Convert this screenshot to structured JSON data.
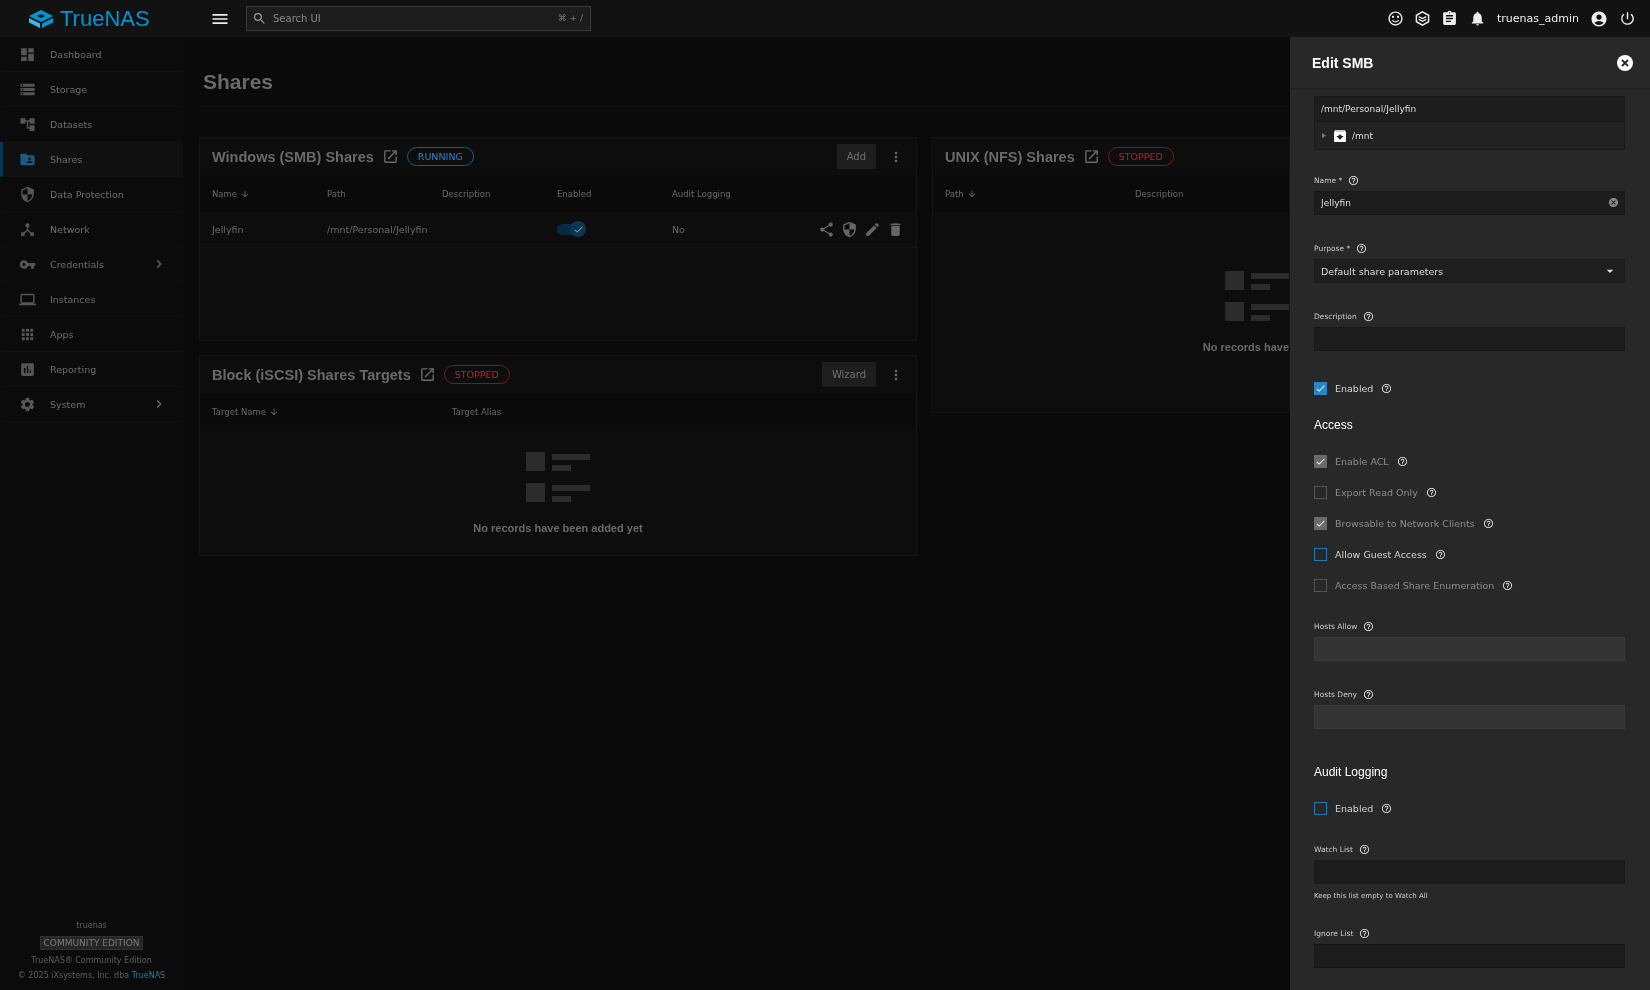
{
  "topbar": {
    "brand": "TrueNAS",
    "search": {
      "placeholder": "Search UI",
      "shortcut": "⌘ + /"
    },
    "user": "truenas_admin"
  },
  "sidebar": {
    "items": [
      {
        "label": "Dashboard",
        "selected": false,
        "has_submenu": false
      },
      {
        "label": "Storage",
        "selected": false,
        "has_submenu": false
      },
      {
        "label": "Datasets",
        "selected": false,
        "has_submenu": false
      },
      {
        "label": "Shares",
        "selected": true,
        "has_submenu": false
      },
      {
        "label": "Data Protection",
        "selected": false,
        "has_submenu": false
      },
      {
        "label": "Network",
        "selected": false,
        "has_submenu": false
      },
      {
        "label": "Credentials",
        "selected": false,
        "has_submenu": true
      },
      {
        "label": "Instances",
        "selected": false,
        "has_submenu": false
      },
      {
        "label": "Apps",
        "selected": false,
        "has_submenu": false
      },
      {
        "label": "Reporting",
        "selected": false,
        "has_submenu": false
      },
      {
        "label": "System",
        "selected": false,
        "has_submenu": true
      }
    ],
    "footer": {
      "hostname": "truenas",
      "edition": "COMMUNITY EDITION",
      "product": "TrueNAS® Community Edition",
      "copyright": "© 2025 iXsystems, Inc. dba",
      "link": "TrueNAS"
    }
  },
  "page": {
    "title": "Shares"
  },
  "left_cards": [
    {
      "title": "Windows (SMB) Shares",
      "status": {
        "label": "RUNNING",
        "kind": "running"
      },
      "button": "Add",
      "columns": [
        {
          "label": "Name",
          "sorted": true
        },
        {
          "label": "Path",
          "sorted": false
        },
        {
          "label": "Description",
          "sorted": false
        },
        {
          "label": "Enabled",
          "sorted": false
        },
        {
          "label": "Audit Logging",
          "sorted": false
        }
      ],
      "rows": [
        {
          "name": "Jellyfin",
          "path": "/mnt/Personal/Jellyfin",
          "enabled": true,
          "audit_logging": "No"
        }
      ]
    },
    {
      "title": "Block (iSCSI) Shares Targets",
      "status": {
        "label": "STOPPED",
        "kind": "stopped"
      },
      "button": "Wizard",
      "columns": [
        {
          "label": "Target Name",
          "sorted": true
        },
        {
          "label": "Target Alias",
          "sorted": false
        }
      ],
      "empty_text": "No records have been added yet"
    }
  ],
  "right_cards": [
    {
      "title": "UNIX (NFS) Shares",
      "status": {
        "label": "STOPPED",
        "kind": "stopped"
      },
      "columns": [
        {
          "label": "Path",
          "sorted": true
        },
        {
          "label": "Description",
          "sorted": false
        }
      ],
      "empty_text": "No records have"
    }
  ],
  "drawer": {
    "title": "Edit SMB",
    "fields": [
      {
        "kind": "explorer",
        "value": "/mnt/Personal/Jellyfin",
        "node": "/mnt"
      },
      {
        "kind": "text",
        "label": "Name *",
        "value": "Jellyfin",
        "clearable": true,
        "disabled": false
      },
      {
        "kind": "select",
        "label": "Purpose *",
        "value": "Default share parameters"
      },
      {
        "kind": "text",
        "label": "Description",
        "disabled": false
      },
      {
        "kind": "checkbox",
        "label": "Enabled",
        "checked": true,
        "disabled": false
      },
      {
        "kind": "heading",
        "label": "Access"
      },
      {
        "kind": "checkbox",
        "label": "Enable ACL",
        "checked": true,
        "disabled": true
      },
      {
        "kind": "checkbox",
        "label": "Export Read Only",
        "checked": false,
        "disabled": true
      },
      {
        "kind": "checkbox",
        "label": "Browsable to Network Clients",
        "checked": true,
        "disabled": true
      },
      {
        "kind": "checkbox",
        "label": "Allow Guest Access",
        "checked": false,
        "disabled": false
      },
      {
        "kind": "checkbox",
        "label": "Access Based Share Enumeration",
        "checked": false,
        "disabled": true
      },
      {
        "kind": "text",
        "label": "Hosts Allow",
        "disabled": true
      },
      {
        "kind": "text",
        "label": "Hosts Deny",
        "disabled": true
      },
      {
        "kind": "heading",
        "label": "Audit Logging"
      },
      {
        "kind": "checkbox",
        "label": "Enabled",
        "checked": false,
        "disabled": false
      },
      {
        "kind": "text",
        "label": "Watch List",
        "hint": "Keep this list empty to Watch All",
        "disabled": false
      },
      {
        "kind": "text",
        "label": "Ignore List",
        "disabled": false
      }
    ]
  }
}
